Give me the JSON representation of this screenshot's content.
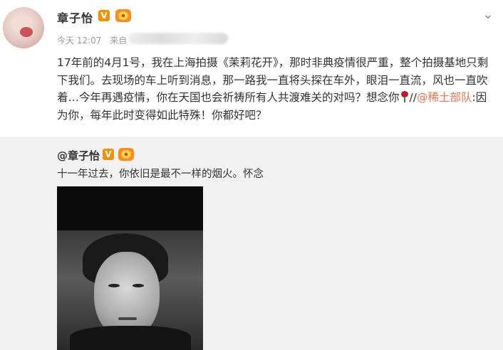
{
  "author": {
    "name": "章子怡",
    "verified_badge": "V"
  },
  "meta": {
    "time": "今天 12:07",
    "source_prefix": "来自"
  },
  "post": {
    "text_part1": "17年前的4月1号，我在上海拍摄《茉莉花开》，那时非典疫情很严重，整个拍摄基地只剩下我们。去现场的车上听到消息，那一路我一直将头探在车外，眼泪一直流，风也一直吹着…今年再遇疫情，你在天国也会祈祷所有人共渡难关的对吗？想念你",
    "text_sep": "//",
    "mention": "@稀土部队",
    "text_part2": ":因为你，每年此时变得如此特殊！你都好吧？"
  },
  "repost": {
    "author": "@章子怡",
    "verified_badge": "V",
    "text": "十一年过去，你依旧是最不一样的烟火。怀念"
  },
  "icons": {
    "menu": "chevron-down-icon",
    "rose": "rose-emoji-icon"
  },
  "colors": {
    "mention": "#eb7350",
    "verified": "#f29200",
    "repost_bg": "#f2f2f2"
  }
}
